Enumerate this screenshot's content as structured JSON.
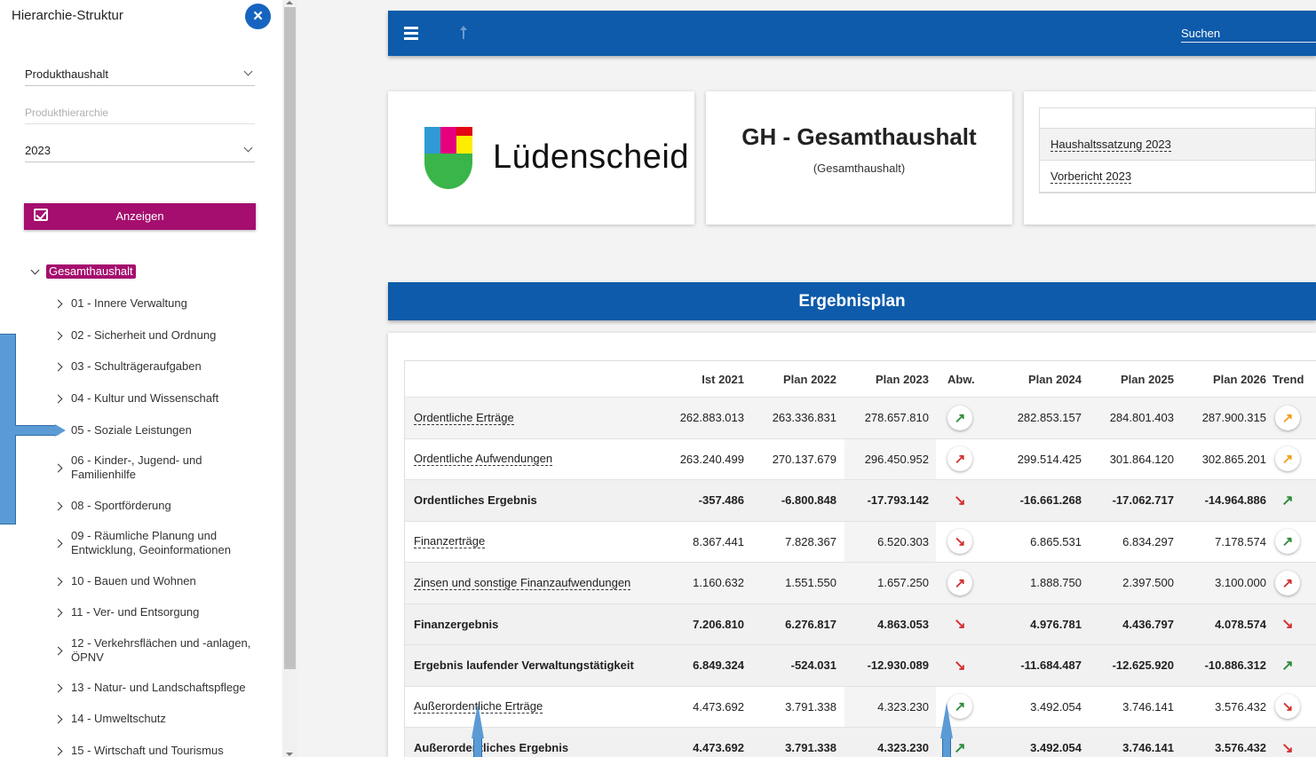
{
  "sidebar": {
    "title": "Hierarchie-Struktur",
    "close_icon": "close-icon",
    "budget_select": "Produkthaushalt",
    "hierarchy_placeholder": "Produkthierarchie",
    "year_select": "2023",
    "show_button": "Anzeigen",
    "tree_root": "Gesamthaushalt",
    "tree_items": [
      "01 - Innere Verwaltung",
      "02 - Sicherheit und Ordnung",
      "03 - Schulträgeraufgaben",
      "04 - Kultur und Wissenschaft",
      "05 - Soziale Leistungen",
      "06 - Kinder-, Jugend- und Familienhilfe",
      "08 - Sportförderung",
      "09 - Räumliche Planung und Entwicklung, Geoinformationen",
      "10 - Bauen und Wohnen",
      "11 - Ver- und Entsorgung",
      "12 - Verkehrsflächen und -anlagen, ÖPNV",
      "13 - Natur- und Landschaftspflege",
      "14 - Umweltschutz",
      "15 - Wirtschaft und Tourismus"
    ]
  },
  "topbar": {
    "search_label": "Suchen"
  },
  "header": {
    "logo_text": "Lüdenscheid",
    "title": "GH - Gesamthaushalt",
    "subtitle": "(Gesamthaushalt)",
    "links": [
      "Haushaltssatzung 2023",
      "Vorbericht 2023"
    ]
  },
  "plan": {
    "title": "Ergebnisplan",
    "columns": [
      "",
      "Ist 2021",
      "Plan 2022",
      "Plan 2023",
      "Abw.",
      "Plan 2024",
      "Plan 2025",
      "Plan 2026",
      "Trend"
    ],
    "rows": [
      {
        "label": "Ordentliche Erträge",
        "values": [
          "262.883.013",
          "263.336.831",
          "278.657.810",
          "282.853.157",
          "284.801.403",
          "287.900.315"
        ],
        "abw": "up-green",
        "trend": "up-orange"
      },
      {
        "label": "Ordentliche Aufwendungen",
        "values": [
          "263.240.499",
          "270.137.679",
          "296.450.952",
          "299.514.425",
          "301.864.120",
          "302.865.201"
        ],
        "abw": "up-red",
        "trend": "up-orange"
      },
      {
        "label": "Ordentliches Ergebnis",
        "values": [
          "-357.486",
          "-6.800.848",
          "-17.793.142",
          "-16.661.268",
          "-17.062.717",
          "-14.964.886"
        ],
        "abw": "down-red",
        "trend": "up-green"
      },
      {
        "label": "Finanzerträge",
        "values": [
          "8.367.441",
          "7.828.367",
          "6.520.303",
          "6.865.531",
          "6.834.297",
          "7.178.574"
        ],
        "abw": "down-red",
        "trend": "up-green"
      },
      {
        "label": "Zinsen und sonstige Finanzaufwendungen",
        "values": [
          "1.160.632",
          "1.551.550",
          "1.657.250",
          "1.888.750",
          "2.397.500",
          "3.100.000"
        ],
        "abw": "up-red",
        "trend": "up-red"
      },
      {
        "label": "Finanzergebnis",
        "values": [
          "7.206.810",
          "6.276.817",
          "4.863.053",
          "4.976.781",
          "4.436.797",
          "4.078.574"
        ],
        "abw": "down-red",
        "trend": "down-red"
      },
      {
        "label": "Ergebnis laufender Verwaltungstätigkeit",
        "values": [
          "6.849.324",
          "-524.031",
          "-12.930.089",
          "-11.684.487",
          "-12.625.920",
          "-10.886.312"
        ],
        "abw": "down-red",
        "trend": "up-green"
      },
      {
        "label": "Außerordentliche Erträge",
        "values": [
          "4.473.692",
          "3.791.338",
          "4.323.230",
          "3.492.054",
          "3.746.141",
          "3.576.432"
        ],
        "abw": "up-green",
        "trend": "down-red"
      },
      {
        "label": "Außerordentliches Ergebnis",
        "values": [
          "4.473.692",
          "3.791.338",
          "4.323.230",
          "3.492.054",
          "3.746.141",
          "3.576.432"
        ],
        "abw": "up-green",
        "trend": "down-red"
      }
    ]
  },
  "colors": {
    "primary_blue": "#0d5baa",
    "accent_magenta": "#a50e6e",
    "trend_green": "#2e8b3c",
    "trend_red": "#d32f2f",
    "trend_orange": "#f39c12"
  }
}
